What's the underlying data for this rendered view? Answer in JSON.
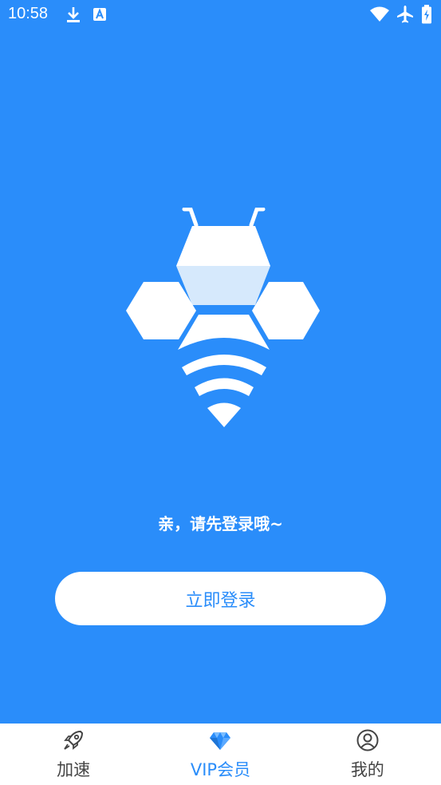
{
  "status_bar": {
    "time": "10:58"
  },
  "main": {
    "prompt": "亲，请先登录哦~",
    "login_button": "立即登录"
  },
  "bottom_nav": {
    "items": [
      {
        "label": "加速",
        "icon": "rocket-icon",
        "active": false
      },
      {
        "label": "VIP会员",
        "icon": "diamond-icon",
        "active": true
      },
      {
        "label": "我的",
        "icon": "user-circle-icon",
        "active": false
      }
    ]
  },
  "colors": {
    "accent": "#2A8DFA",
    "nav_bg": "#FFFFFF",
    "nav_inactive": "#444444"
  }
}
